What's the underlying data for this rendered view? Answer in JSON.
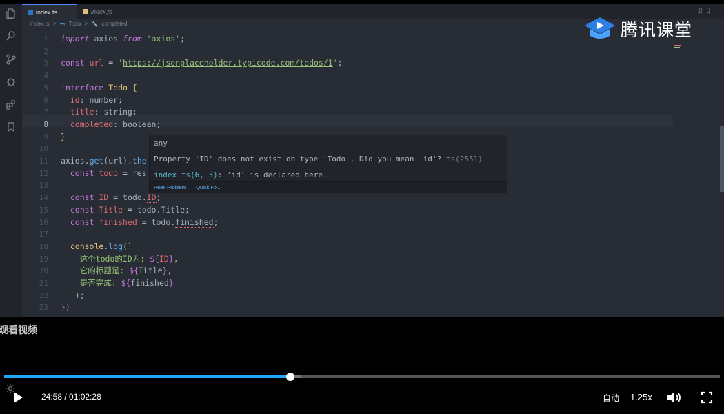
{
  "tabs": [
    {
      "label": "index.ts",
      "icon": "typescript-file-icon",
      "color": "#2f74c0"
    },
    {
      "label": "index.js",
      "icon": "javascript-file-icon",
      "color": "#e5c07b"
    }
  ],
  "breadcrumb": [
    "index.ts",
    ">",
    "Todo",
    ">",
    "completed"
  ],
  "line_numbers": [
    "1",
    "2",
    "3",
    "4",
    "5",
    "6",
    "7",
    "8",
    "9",
    "10",
    "11",
    "12",
    "13",
    "14",
    "15",
    "16",
    "17",
    "18",
    "19",
    "20",
    "21",
    "22",
    "23"
  ],
  "code": {
    "l1": {
      "a": "import",
      "b": " axios ",
      "c": "from",
      "d": " 'axios'",
      "e": ";"
    },
    "l3": {
      "a": "const",
      "b": " url",
      "c": " = ",
      "d": "'",
      "e": "https://jsonplaceholder.typicode.com/todos/1",
      "f": "'",
      "g": ";"
    },
    "l5": {
      "a": "interface",
      "b": " Todo {"
    },
    "l6": {
      "a": "  id",
      "b": ": number;"
    },
    "l7": {
      "a": "  title",
      "b": ": string;"
    },
    "l8": {
      "a": "  completed",
      "b": ": boolean;"
    },
    "l9": {
      "a": "}"
    },
    "l11": {
      "a": "axios",
      "b": ".",
      "c": "get",
      "d": "(url).",
      "e": "the"
    },
    "l12": {
      "a": "  const",
      "b": " todo",
      "c": " = ",
      "d": "res"
    },
    "l14": {
      "a": "  const",
      "b": " ID",
      "c": " = todo.",
      "d": "ID",
      "e": ";"
    },
    "l15": {
      "a": "  const",
      "b": " Title",
      "c": " = todo.Title;"
    },
    "l16": {
      "a": "  const",
      "b": " finished",
      "c": " = todo.",
      "d": "finished",
      "e": ";"
    },
    "l18": {
      "a": "  console",
      "b": ".",
      "c": "log",
      "d": "(`"
    },
    "l19": {
      "a": "    这个todo的ID为: ",
      "b": "${",
      "c": "ID",
      "d": "}",
      "e": ","
    },
    "l20": {
      "a": "    它的标题是: ",
      "b": "${",
      "c": "Title",
      "d": "}",
      "e": ","
    },
    "l21": {
      "a": "    是否完成: ",
      "b": "${",
      "c": "finished",
      "d": "}"
    },
    "l22": {
      "a": "  `",
      "b": ");"
    },
    "l23": {
      "a": "})"
    }
  },
  "hover": {
    "type_line": "any",
    "error_prefix": "Property 'ID' does not exist on type 'Todo'. Did you mean 'id'?",
    "error_code": " ts(2551)",
    "decl_file": "index.ts(6, 3)",
    "decl_rest": ": 'id' is declared here.",
    "peek_problem": "Peek Problem",
    "quick_fix": "Quick Fix..."
  },
  "watermark": {
    "text": "腾讯课堂"
  },
  "watch_text": "观看视频",
  "player": {
    "current_time": "24:58",
    "separator": " / ",
    "duration": "01:02:28",
    "progress_fraction": 0.3997,
    "buffer_fraction": 0.414,
    "auto_label": "自动",
    "speed_label": "1.25x",
    "accent_color": "#1ea7fd"
  }
}
